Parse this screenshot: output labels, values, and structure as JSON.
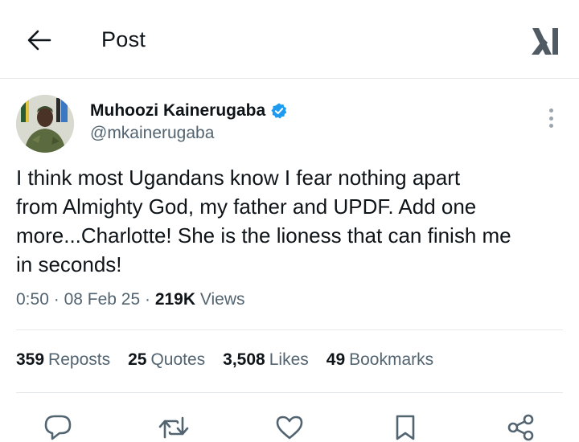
{
  "header": {
    "title": "Post"
  },
  "author": {
    "display_name": "Muhoozi Kainerugaba",
    "handle": "@mkainerugaba",
    "verified": true
  },
  "tweet": {
    "text": "I think most Ugandans know I fear nothing apart\nfrom Almighty God, my father and UPDF. Add one\nmore...Charlotte! She is the lioness that can finish me\nin seconds!",
    "time": "0:50",
    "separator": "·",
    "date": "08 Feb 25",
    "views_count": "219K",
    "views_label": "Views"
  },
  "stats": {
    "reposts": {
      "count": "359",
      "label": "Reposts"
    },
    "quotes": {
      "count": "25",
      "label": "Quotes"
    },
    "likes": {
      "count": "3,508",
      "label": "Likes"
    },
    "bookmarks": {
      "count": "49",
      "label": "Bookmarks"
    }
  },
  "colors": {
    "text_primary": "#0f1419",
    "text_secondary": "#536471",
    "verified_blue": "#1d9bf0",
    "divider": "#e6e9eb"
  },
  "icons": [
    "back-arrow-icon",
    "xai-logo",
    "verified-badge-icon",
    "more-vertical-icon",
    "reply-icon",
    "repost-icon",
    "like-icon",
    "bookmark-icon",
    "share-icon"
  ]
}
